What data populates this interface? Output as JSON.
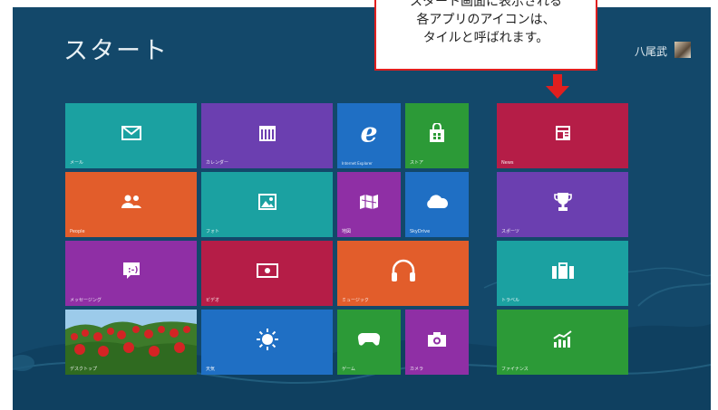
{
  "start_label": "スタート",
  "user_name": "八尾武",
  "callout": {
    "line1": "スタート画面に表示される",
    "line2": "各アプリのアイコンは、",
    "line3": "タイルと呼ばれます。"
  },
  "colors": {
    "background": "#13486a",
    "callout_border": "#e01f1f",
    "teal": "#1ba1a1",
    "purple": "#6b3fb0",
    "blue": "#1f6fc4",
    "green": "#2c9a37",
    "orange": "#e25d2b",
    "crimson": "#b51d47",
    "magenta": "#8f2fa5"
  },
  "tiles": [
    {
      "name": "tile-mail",
      "label": "メール",
      "icon": "mail-icon"
    },
    {
      "name": "tile-calendar",
      "label": "カレンダー",
      "icon": "calendar-icon"
    },
    {
      "name": "tile-internet-explorer",
      "label": "Internet Explorer",
      "icon": "internet-explorer-icon"
    },
    {
      "name": "tile-store",
      "label": "ストア",
      "icon": "store-icon"
    },
    {
      "name": "tile-news",
      "label": "News",
      "icon": "news-icon"
    },
    {
      "name": "tile-people",
      "label": "People",
      "icon": "people-icon"
    },
    {
      "name": "tile-photos",
      "label": "フォト",
      "icon": "photo-icon"
    },
    {
      "name": "tile-maps",
      "label": "地図",
      "icon": "map-icon"
    },
    {
      "name": "tile-skydrive",
      "label": "SkyDrive",
      "icon": "cloud-icon"
    },
    {
      "name": "tile-sports",
      "label": "スポーツ",
      "icon": "trophy-icon"
    },
    {
      "name": "tile-messaging",
      "label": "メッセージング",
      "icon": "messaging-icon"
    },
    {
      "name": "tile-video",
      "label": "ビデオ",
      "icon": "video-icon"
    },
    {
      "name": "tile-music",
      "label": "ミュージック",
      "icon": "headphones-icon"
    },
    {
      "name": "tile-travel",
      "label": "トラベル",
      "icon": "suitcase-icon"
    },
    {
      "name": "tile-desktop",
      "label": "デスクトップ",
      "icon": "tulip-field-image"
    },
    {
      "name": "tile-weather",
      "label": "天気",
      "icon": "sun-icon"
    },
    {
      "name": "tile-games",
      "label": "ゲーム",
      "icon": "gamepad-icon"
    },
    {
      "name": "tile-camera",
      "label": "カメラ",
      "icon": "camera-icon"
    },
    {
      "name": "tile-finance",
      "label": "ファイナンス",
      "icon": "chart-up-icon"
    }
  ]
}
